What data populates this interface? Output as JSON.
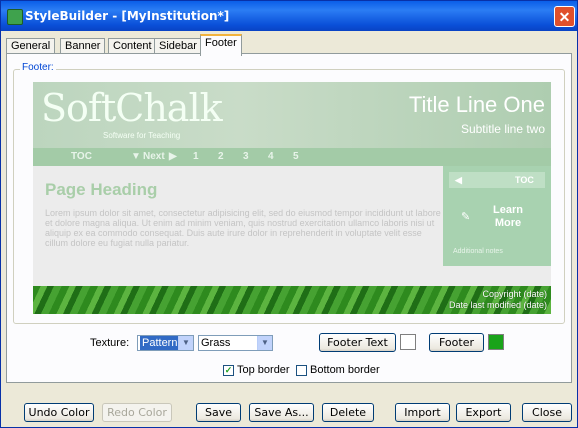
{
  "window": {
    "title": "StyleBuilder - [MyInstitution*]"
  },
  "tabs": [
    {
      "label": "General"
    },
    {
      "label": "Banner"
    },
    {
      "label": "Content"
    },
    {
      "label": "Sidebar"
    },
    {
      "label": "Footer",
      "active": true
    }
  ],
  "group": {
    "label": "Footer:"
  },
  "preview": {
    "logo": "SoftChalk",
    "logo_sub": "Software for Teaching",
    "title_line": "Title Line One",
    "subtitle_line": "Subtitle line two",
    "nav": {
      "toc": "TOC",
      "next": "Next",
      "pages": [
        "1",
        "2",
        "3",
        "4",
        "5"
      ]
    },
    "page_heading": "Page Heading",
    "lorem": "Lorem ipsum dolor sit amet, consectetur adipisicing elit, sed do eiusmod tempor incididunt ut labore et dolore magna aliqua. Ut enim ad minim veniam, quis nostrud exercitation ullamco laboris nisi ut aliquip ex ea commodo consequat. Duis aute irure dolor in reprehenderit in voluptate velit esse cillum dolore eu fugiat nulla pariatur.",
    "sidebar": {
      "toc": "TOC",
      "learn": "Learn",
      "more": "More",
      "additional": "Additional notes"
    },
    "footer": {
      "copyright": "Copyright (date)",
      "modified": "Date last modified (date)"
    }
  },
  "controls": {
    "texture_label": "Texture:",
    "texture_type": "Pattern",
    "texture_name": "Grass",
    "footer_text_button": "Footer Text",
    "footer_button": "Footer",
    "top_border_label": "Top border",
    "top_border_checked": true,
    "bottom_border_label": "Bottom border",
    "bottom_border_checked": false
  },
  "buttons": {
    "undo_color": "Undo Color",
    "redo_color": "Redo Color",
    "save": "Save",
    "save_as": "Save As...",
    "delete": "Delete",
    "import": "Import",
    "export": "Export",
    "close": "Close"
  },
  "colors": {
    "footer_text_swatch": "#ffffff",
    "footer_swatch": "#1aa31a",
    "banner_tint": "#bcd5be",
    "footer_pattern": "#3f9a2c"
  }
}
